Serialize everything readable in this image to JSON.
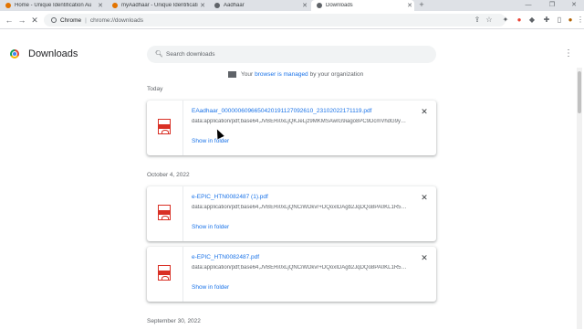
{
  "browser": {
    "tabs": [
      {
        "title": "Home - Unique Identification Au",
        "favicon_color": "#e37400",
        "active": false
      },
      {
        "title": "myAadhaar - Unique Identificatio",
        "favicon_color": "#e37400",
        "active": false
      },
      {
        "title": "Aadhaar",
        "favicon_color": "#5f6368",
        "active": false
      },
      {
        "title": "Downloads",
        "favicon_color": "#5f6368",
        "active": true
      }
    ],
    "new_tab_label": "+",
    "address": {
      "site_label": "Chrome",
      "separator": "|",
      "url": "chrome://downloads"
    }
  },
  "page": {
    "title": "Downloads",
    "search_placeholder": "Search downloads",
    "managed_notice": {
      "prefix": "Your",
      "link": "browser is managed",
      "suffix": "by your organization"
    }
  },
  "groups": [
    {
      "date": "Today",
      "items": [
        {
          "filename": "EAadhaar_0000006096650420191127092610_23102022171119.pdf",
          "url": "data:application/pdf;base64,JVBERi0xLjQKJeLjz9MKMSAwIG9iago8PC9DcmVhdG9yIChNaWNyb3Nv",
          "show_label": "Show in folder"
        }
      ]
    },
    {
      "date": "October 4, 2022",
      "items": [
        {
          "filename": "e-EPIC_HTN0082487 (1).pdf",
          "url": "data:application/pdf;base64,JVBERi0xLjQNCiWDkvr+DQoxIDAgb2JqDQo8PA0KL1R5cGUgL0NhdGFs",
          "show_label": "Show in folder"
        },
        {
          "filename": "e-EPIC_HTN0082487.pdf",
          "url": "data:application/pdf;base64,JVBERi0xLjQNCiWDkvr+DQoxIDAgb2JqDQo8PA0KL1R5cGUgL0NhdGFs",
          "show_label": "Show in folder"
        }
      ]
    },
    {
      "date": "September 30, 2022",
      "items": []
    }
  ]
}
